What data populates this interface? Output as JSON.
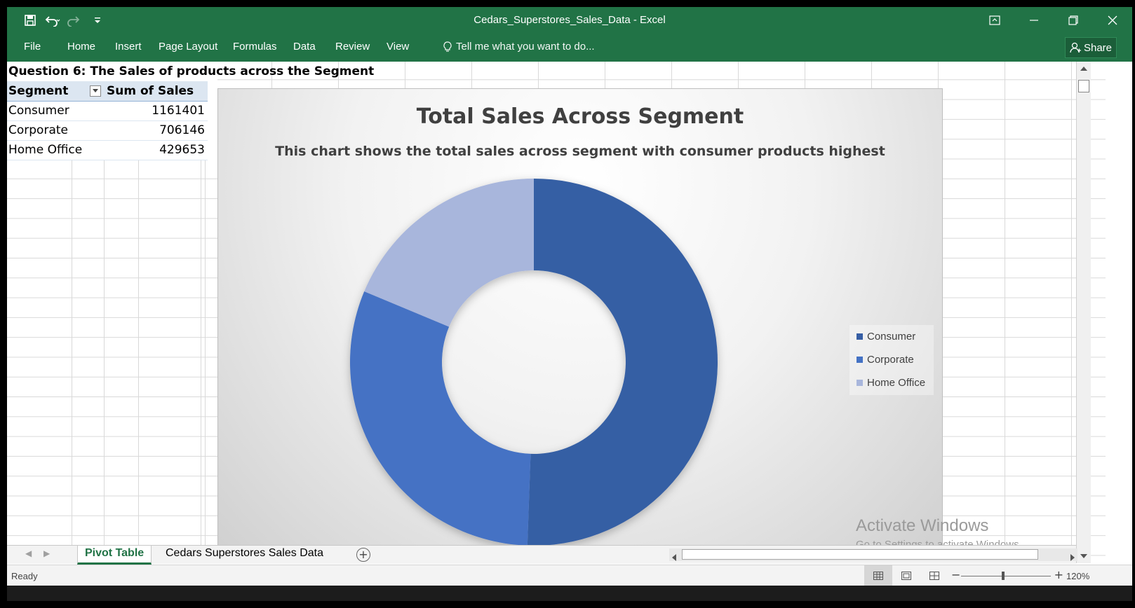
{
  "window": {
    "title": "Cedars_Superstores_Sales_Data - Excel"
  },
  "ribbon": {
    "tabs": [
      "File",
      "Home",
      "Insert",
      "Page Layout",
      "Formulas",
      "Data",
      "Review",
      "View"
    ],
    "tell_me": "Tell me what you want to do...",
    "share": "Share"
  },
  "sheet": {
    "question_title": "Question 6: The Sales of products across the Segment",
    "pivot": {
      "headers": [
        "Segment",
        "Sum of Sales"
      ],
      "rows": [
        {
          "label": "Consumer",
          "value": "1161401"
        },
        {
          "label": "Corporate",
          "value": "706146"
        },
        {
          "label": "Home Office",
          "value": "429653"
        }
      ]
    }
  },
  "chart_data": {
    "type": "pie",
    "variant": "donut",
    "title": "Total Sales Across Segment",
    "subtitle": "This chart shows the total sales across segment with consumer products highest",
    "categories": [
      "Consumer",
      "Corporate",
      "Home Office"
    ],
    "values": [
      1161401,
      706146,
      429653
    ],
    "colors": [
      "#365ea4",
      "#4472c4",
      "#a8b6dc"
    ],
    "legend": "right"
  },
  "sheet_tabs": {
    "active": "Pivot Table",
    "other": "Cedars Superstores Sales Data"
  },
  "watermark": {
    "line1": "Activate Windows",
    "line2": "Go to Settings to activate Windows."
  },
  "status": {
    "text": "Ready",
    "zoom": "120%"
  },
  "colors": {
    "excel_green": "#217346"
  }
}
